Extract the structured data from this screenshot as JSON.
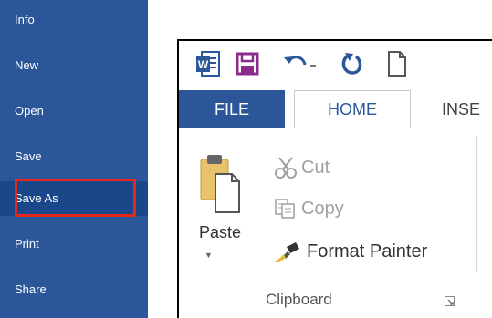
{
  "backstage": {
    "items": [
      {
        "label": "Info"
      },
      {
        "label": "New"
      },
      {
        "label": "Open"
      },
      {
        "label": "Save"
      },
      {
        "label": "Save As"
      },
      {
        "label": "Print"
      },
      {
        "label": "Share"
      }
    ],
    "selected": "Save As",
    "highlight_color": "#e8271c",
    "background_color": "#2b579a"
  },
  "word": {
    "quick_access": {
      "icons": [
        "word-logo-icon",
        "save-icon",
        "undo-icon",
        "redo-icon",
        "new-document-icon"
      ]
    },
    "tabs": [
      {
        "label": "FILE"
      },
      {
        "label": "HOME"
      },
      {
        "label": "INSE"
      }
    ],
    "active_tab": "HOME",
    "ribbon": {
      "paste_label": "Paste",
      "cut_label": "Cut",
      "copy_label": "Copy",
      "format_painter_label": "Format Painter",
      "group_label": "Clipboard"
    },
    "accent_color": "#2b579a"
  }
}
